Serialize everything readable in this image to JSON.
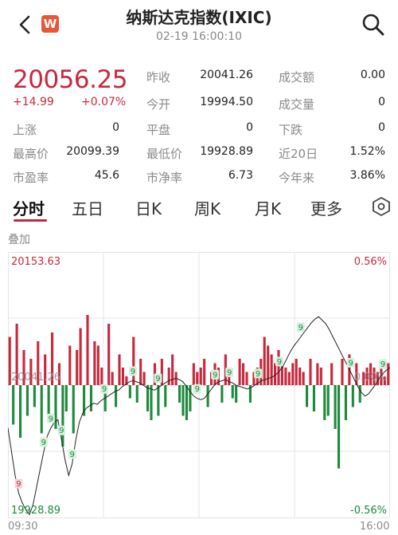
{
  "header": {
    "back_icon": "chevron-left-icon",
    "logo_letter": "W",
    "title": "纳斯达克指数(IXIC)",
    "subtitle": "02-19 16:00:10",
    "search_icon": "search-icon"
  },
  "quote": {
    "price": "20056.25",
    "change": "+14.99",
    "change_pct": "+0.07%"
  },
  "stats": {
    "prev_close": {
      "label": "昨收",
      "value": "20041.26"
    },
    "turnover": {
      "label": "成交额",
      "value": "0.00"
    },
    "open": {
      "label": "今开",
      "value": "19994.50"
    },
    "volume": {
      "label": "成交量",
      "value": "0"
    },
    "up": {
      "label": "上涨",
      "value": "0"
    },
    "flat": {
      "label": "平盘",
      "value": "0"
    },
    "down": {
      "label": "下跌",
      "value": "0"
    },
    "high": {
      "label": "最高价",
      "value": "20099.39"
    },
    "low": {
      "label": "最低价",
      "value": "19928.89"
    },
    "day20": {
      "label": "近20日",
      "value": "1.52%"
    },
    "pe": {
      "label": "市盈率",
      "value": "45.6"
    },
    "pb": {
      "label": "市净率",
      "value": "6.73"
    },
    "ytd": {
      "label": "今年来",
      "value": "3.86%"
    }
  },
  "tabs": [
    "分时",
    "五日",
    "日K",
    "周K",
    "月K",
    "更多"
  ],
  "active_tab": 0,
  "stack_label": "叠加",
  "chart_data": {
    "type": "line",
    "y_top": "20153.63",
    "y_mid": "20041.26",
    "y_bottom": "19928.89",
    "pct_top": "0.56%",
    "pct_mid": "0.00%",
    "pct_bottom": "-0.56%",
    "x_start": "09:30",
    "x_end": "16:00",
    "ylim": [
      19928.89,
      20153.63
    ],
    "colors": {
      "up": "#c8283c",
      "down": "#1e8a3c",
      "line": "#222222",
      "grid": "#e4e4e4"
    },
    "price_series": [
      20005,
      19985,
      19965,
      19950,
      19942,
      19936,
      19932,
      19940,
      19955,
      19970,
      19985,
      19998,
      20005,
      20010,
      20012,
      19995,
      19978,
      19965,
      19975,
      19995,
      20010,
      20018,
      20022,
      20024,
      20026,
      20025,
      20028,
      20030,
      20032,
      20034,
      20036,
      20037,
      20040,
      20042,
      20044,
      20045,
      20044,
      20043,
      20041,
      20039,
      20038,
      20037,
      20039,
      20041,
      20043,
      20045,
      20046,
      20047,
      20046,
      20044,
      20040,
      20036,
      20032,
      20030,
      20029,
      20030,
      20034,
      20038,
      20042,
      20044,
      20045,
      20046,
      20044,
      20043,
      20041,
      20040,
      20039,
      20038,
      20039,
      20041,
      20043,
      20045,
      20046,
      20047,
      20048,
      20050,
      20053,
      20057,
      20063,
      20069,
      20074,
      20078,
      20082,
      20086,
      20090,
      20094,
      20097,
      20099,
      20096,
      20093,
      20088,
      20082,
      20076,
      20070,
      20064,
      20058,
      20052,
      20046,
      20040,
      20035,
      20032,
      20034,
      20038,
      20042,
      20047,
      20051,
      20054,
      20056
    ],
    "bar_series": [
      55,
      -45,
      70,
      -60,
      40,
      -35,
      30,
      -25,
      50,
      -55,
      35,
      -40,
      60,
      -50,
      25,
      -70,
      -30,
      45,
      -55,
      40,
      65,
      -35,
      80,
      -30,
      50,
      45,
      20,
      -30,
      70,
      15,
      -25,
      35,
      20,
      10,
      -15,
      55,
      -20,
      30,
      15,
      -30,
      -40,
      25,
      -35,
      30,
      -25,
      20,
      35,
      15,
      -20,
      -35,
      -40,
      -30,
      25,
      15,
      20,
      30,
      -25,
      15,
      25,
      20,
      -20,
      35,
      20,
      -15,
      -20,
      30,
      25,
      15,
      -20,
      15,
      20,
      30,
      55,
      45,
      35,
      25,
      40,
      30,
      20,
      15,
      25,
      30,
      20,
      15,
      -25,
      30,
      -30,
      25,
      20,
      -40,
      -35,
      25,
      -50,
      -95,
      30,
      -40,
      35,
      -25,
      25,
      -20,
      15,
      20,
      25,
      20,
      15,
      20,
      10,
      25
    ],
    "markers": [
      {
        "i": 3,
        "label": "9"
      },
      {
        "i": 10,
        "label": "9"
      },
      {
        "i": 12,
        "label": "9"
      },
      {
        "i": 15,
        "label": "9"
      },
      {
        "i": 18,
        "label": "9"
      },
      {
        "i": 27,
        "label": "9"
      },
      {
        "i": 35,
        "label": "9"
      },
      {
        "i": 42,
        "label": "9"
      },
      {
        "i": 53,
        "label": "9"
      },
      {
        "i": 58,
        "label": "9"
      },
      {
        "i": 62,
        "label": "9"
      },
      {
        "i": 70,
        "label": "9"
      },
      {
        "i": 76,
        "label": "9"
      },
      {
        "i": 82,
        "label": "9"
      },
      {
        "i": 96,
        "label": "9"
      },
      {
        "i": 105,
        "label": "9"
      }
    ]
  }
}
